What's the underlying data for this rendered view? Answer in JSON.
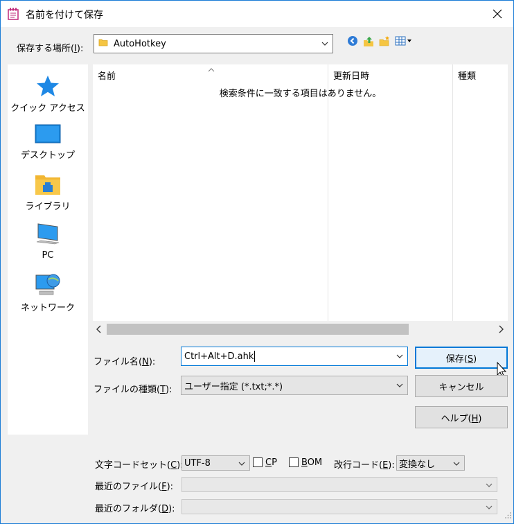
{
  "window": {
    "title": "名前を付けて保存",
    "accent": "#0078d7"
  },
  "location": {
    "label": "保存する場所(",
    "key": "I",
    "suffix": "):",
    "value": "AutoHotkey"
  },
  "toolbar": {
    "icons": [
      "back-icon",
      "up-folder-icon",
      "new-folder-icon",
      "view-menu-icon"
    ]
  },
  "places": [
    {
      "label": "クイック アクセス",
      "icon": "star-icon"
    },
    {
      "label": "デスクトップ",
      "icon": "desktop-icon"
    },
    {
      "label": "ライブラリ",
      "icon": "library-icon"
    },
    {
      "label": "PC",
      "icon": "pc-icon"
    },
    {
      "label": "ネットワーク",
      "icon": "network-icon"
    }
  ],
  "filelist": {
    "columns": [
      "名前",
      "更新日時",
      "種類"
    ],
    "empty_message": "検索条件に一致する項目はありません。"
  },
  "filename": {
    "label": "ファイル名(",
    "key": "N",
    "suffix": "):",
    "value": "Ctrl+Alt+D.ahk"
  },
  "filetype": {
    "label": "ファイルの種類(",
    "key": "T",
    "suffix": "):",
    "value": "ユーザー指定 (*.txt;*.*)"
  },
  "buttons": {
    "save": {
      "label": "保存(",
      "key": "S",
      "suffix": ")"
    },
    "cancel": "キャンセル",
    "help": {
      "label": "ヘルプ(",
      "key": "H",
      "suffix": ")"
    }
  },
  "encoding": {
    "label": "文字コードセット(",
    "key": "C",
    "suffix": "):",
    "value": "UTF-8",
    "cp_label": "P",
    "cp_key": "C",
    "bom_label": "OM",
    "bom_key": "B",
    "newline_label": "改行コード(",
    "newline_key": "E",
    "newline_suffix": "):",
    "newline_value": "変換なし"
  },
  "recent_file": {
    "label": "最近のファイル(",
    "key": "F",
    "suffix": "):"
  },
  "recent_folder": {
    "label": "最近のフォルダ(",
    "key": "D",
    "suffix": "):"
  }
}
